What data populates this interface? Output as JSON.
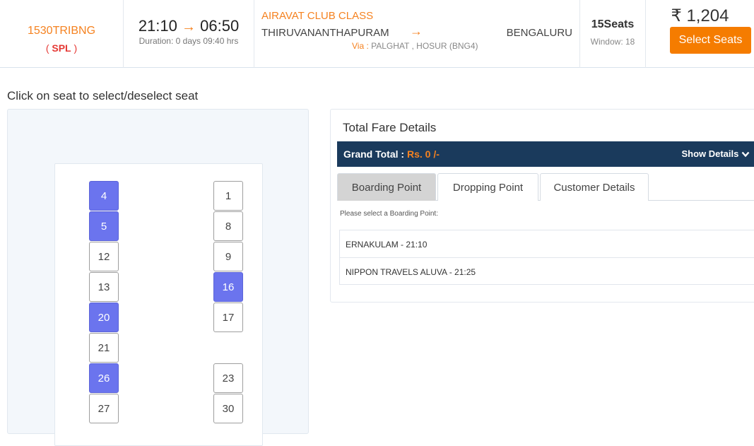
{
  "trip": {
    "service_code": "1530TRIBNG",
    "service_type": "SPL",
    "departure": "21:10",
    "arrival": "06:50",
    "time_arrow": "→",
    "duration": "Duration: 0 days 09:40 hrs",
    "bus_class": "AIRAVAT CLUB CLASS",
    "from": "THIRUVANANTHAPURAM",
    "route_arrow": "→",
    "to": "BENGALURU",
    "via_label": "Via :",
    "via": "PALGHAT , HOSUR (BNG4)",
    "seats": "15Seats",
    "window": "Window: 18",
    "fare": "₹ 1,204",
    "select_button": "Select Seats"
  },
  "instruction": "Click on seat to select/deselect seat",
  "seat_layout": {
    "seats": [
      {
        "label": "4",
        "state": "booked"
      },
      {
        "label": "5",
        "state": "booked"
      },
      {
        "label": "12",
        "state": "available"
      },
      {
        "label": "13",
        "state": "available"
      },
      {
        "label": "20",
        "state": "booked"
      },
      {
        "label": "21",
        "state": "available"
      },
      {
        "label": "26",
        "state": "booked"
      },
      {
        "label": "27",
        "state": "available"
      },
      {
        "label": "1",
        "state": "available"
      },
      {
        "label": "8",
        "state": "available"
      },
      {
        "label": "9",
        "state": "available"
      },
      {
        "label": "16",
        "state": "booked"
      },
      {
        "label": "17",
        "state": "available"
      },
      {
        "label": "23",
        "state": "available"
      },
      {
        "label": "30",
        "state": "available"
      }
    ]
  },
  "fare_details": {
    "title": "Total Fare Details",
    "grand_total_label": "Grand Total :",
    "grand_total_value": "Rs. 0 /-",
    "show_details": "Show Details",
    "tabs": [
      {
        "label": "Boarding Point",
        "active": true
      },
      {
        "label": "Dropping Point",
        "active": false
      },
      {
        "label": "Customer Details",
        "active": false
      }
    ],
    "hint": "Please select a Boarding Point:",
    "boarding_points": [
      "ERNAKULAM - 21:10",
      "NIPPON TRAVELS ALUVA - 21:25"
    ]
  },
  "colors": {
    "accent": "#f58220",
    "booked_seat": "#6b74ee",
    "grand_bar": "#1a3a5c"
  }
}
